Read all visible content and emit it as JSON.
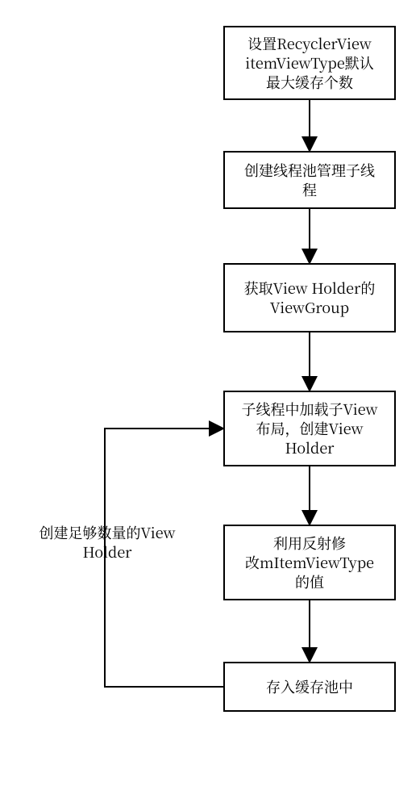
{
  "nodes": {
    "n1": "设置RecyclerView\nitemViewType默认\n最大缓存个数",
    "n2": "创建线程池管理子线\n程",
    "n3": "获取View Holder的\nViewGroup",
    "n4": "子线程中加载子View\n布局，创建View\nHolder",
    "n5": "利用反射修\n改mItemViewType\n的值",
    "n6": "存入缓存池中"
  },
  "loop_label": "创建足够数量的View\nHolder"
}
